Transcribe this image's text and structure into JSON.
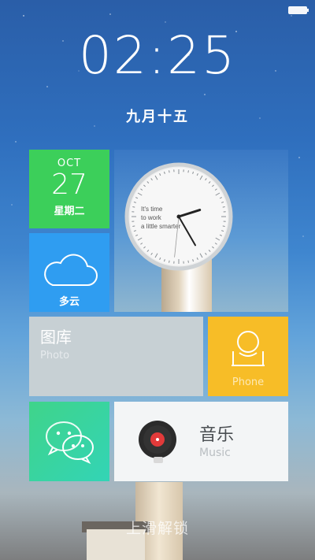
{
  "status": {
    "battery_icon": "battery-icon"
  },
  "lock": {
    "time": "02:25",
    "lunar_date": "九月十五",
    "unlock_hint": "上滑解锁"
  },
  "tiles": {
    "date": {
      "month": "OCT",
      "day": "27",
      "weekday": "星期二",
      "color": "#3ccf5a"
    },
    "clock": {
      "text_line1": "It's time",
      "text_line2": "to work",
      "text_line3": "a little smarter",
      "hour": 2,
      "minute": 25,
      "second": 31
    },
    "weather": {
      "label": "多云",
      "icon": "cloud-icon",
      "color": "#2f9df1"
    },
    "gallery": {
      "title": "图库",
      "subtitle": "Photo",
      "color": "#c7d0d4"
    },
    "phone": {
      "label": "Phone",
      "icon": "phone-icon",
      "color": "#f7bd27"
    },
    "wechat": {
      "icon": "wechat-icon",
      "color": "#3fd48a"
    },
    "music": {
      "title": "音乐",
      "subtitle": "Music",
      "icon": "vinyl-record-icon"
    }
  }
}
